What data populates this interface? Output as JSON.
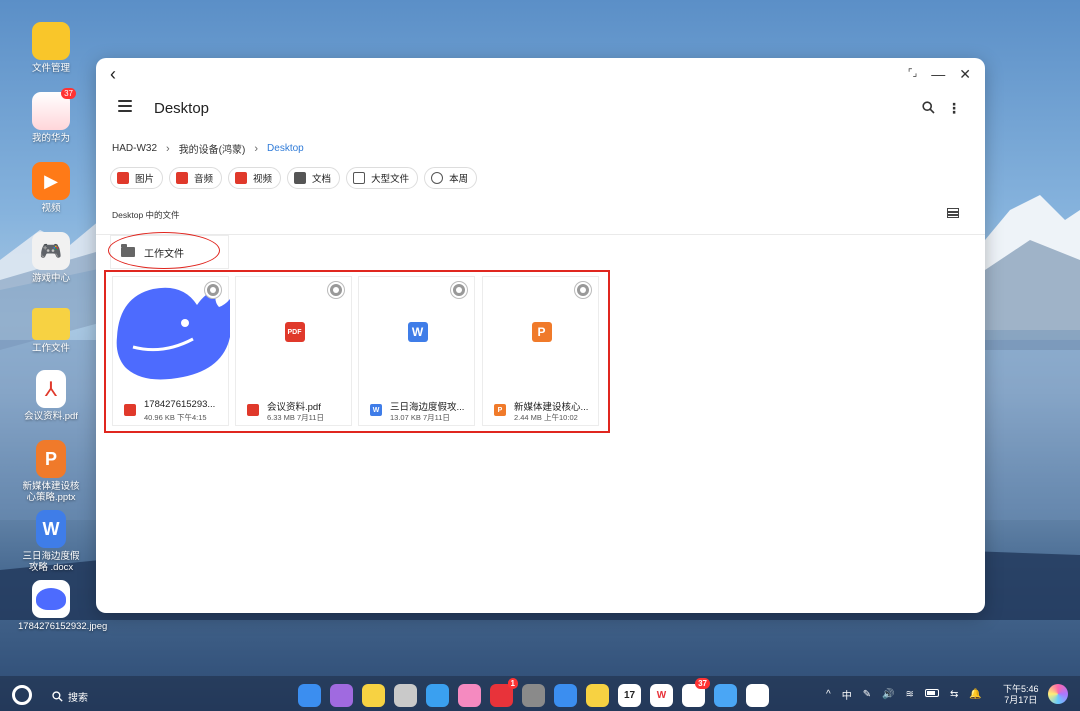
{
  "desktop": {
    "icons": [
      {
        "label": "文件管理",
        "icon": "file-manager-icon",
        "color": "#f9c62a"
      },
      {
        "label": "我的华为",
        "icon": "my-huawei-icon",
        "color": "#f4f4f4",
        "badge": "37"
      },
      {
        "label": "视频",
        "icon": "video-app-icon",
        "color": "#ff7a17"
      },
      {
        "label": "游戏中心",
        "icon": "game-center-icon",
        "color": "#f1f1f1"
      },
      {
        "label": "工作文件",
        "icon": "folder-icon",
        "color": "#f7d242"
      },
      {
        "label": "会议资料.pdf",
        "icon": "pdf-file-icon",
        "color": "#ffffff"
      },
      {
        "label": "新媒体建设核心策略.pptx",
        "icon": "pptx-file-icon",
        "color": "#f07a2a"
      },
      {
        "label": "三日海边度假攻略 .docx",
        "icon": "docx-file-icon",
        "color": "#3f7de8"
      },
      {
        "label": "1784276152932.jpeg",
        "icon": "jpeg-file-icon",
        "color": "#4d6bfe"
      }
    ]
  },
  "window": {
    "title": "Desktop",
    "breadcrumb": [
      "HAD-W32",
      "我的设备(鸿蒙)",
      "Desktop"
    ],
    "chips": [
      {
        "label": "图片",
        "icon": "image-icon",
        "color": "#e0392b"
      },
      {
        "label": "音频",
        "icon": "audio-icon",
        "color": "#e0392b"
      },
      {
        "label": "视频",
        "icon": "video-icon",
        "color": "#e0392b"
      },
      {
        "label": "文档",
        "icon": "document-icon",
        "color": "#555555"
      },
      {
        "label": "大型文件",
        "icon": "tag-icon",
        "color": "#555555"
      },
      {
        "label": "本周",
        "icon": "history-icon",
        "color": "#555555"
      }
    ],
    "section_label": "Desktop 中的文件",
    "folder": {
      "name": "工作文件"
    },
    "files": [
      {
        "name": "178427615293...",
        "meta": "40.96 KB 下午4:15",
        "type": "image",
        "icon_color": "#e0392b",
        "ft_label": ""
      },
      {
        "name": "会议资料.pdf",
        "meta": "6.33 MB 7月11日",
        "type": "pdf",
        "icon_color": "#e0392b",
        "ft_label": "PDF"
      },
      {
        "name": "三日海边度假攻...",
        "meta": "13.07 KB 7月11日",
        "type": "docx",
        "icon_color": "#3f7de8",
        "ft_label": "W"
      },
      {
        "name": "新媒体建设核心...",
        "meta": "2.44 MB 上午10:02",
        "type": "pptx",
        "icon_color": "#f07a2a",
        "ft_label": "P"
      }
    ]
  },
  "taskbar": {
    "search_label": "搜索",
    "apps": [
      {
        "icon": "start-grid-icon",
        "color": "#3b8ef0",
        "label": ""
      },
      {
        "icon": "multitask-icon",
        "color": "#a06ae0",
        "label": ""
      },
      {
        "icon": "notes-icon",
        "color": "#f7d242",
        "label": ""
      },
      {
        "icon": "trash-icon",
        "color": "#c9c9c9",
        "label": ""
      },
      {
        "icon": "browser-icon",
        "color": "#3aa0f0",
        "label": ""
      },
      {
        "icon": "gallery-icon",
        "color": "#f58ac0",
        "label": ""
      },
      {
        "icon": "app-gallery-icon",
        "color": "#e8333a",
        "label": "",
        "badge": "1"
      },
      {
        "icon": "settings-icon",
        "color": "#8a8a8a",
        "label": ""
      },
      {
        "icon": "file-manager-icon",
        "color": "#3b8ef0",
        "label": ""
      },
      {
        "icon": "memo-icon",
        "color": "#f7d242",
        "label": ""
      },
      {
        "icon": "calendar-icon",
        "color": "#ffffff",
        "label": "17"
      },
      {
        "icon": "wps-icon",
        "color": "#ffffff",
        "label": "W"
      },
      {
        "icon": "my-huawei-icon",
        "color": "#ffffff",
        "label": "",
        "badge": "37"
      },
      {
        "icon": "cloud-icon",
        "color": "#4aa6f5",
        "label": ""
      },
      {
        "icon": "deepseek-icon",
        "color": "#ffffff",
        "label": ""
      }
    ],
    "tray": [
      "^",
      "中",
      "✎",
      "🔊",
      "wifi",
      "battery",
      "⇆",
      "🔔"
    ],
    "time": "下午5:46",
    "date": "7月17日"
  }
}
